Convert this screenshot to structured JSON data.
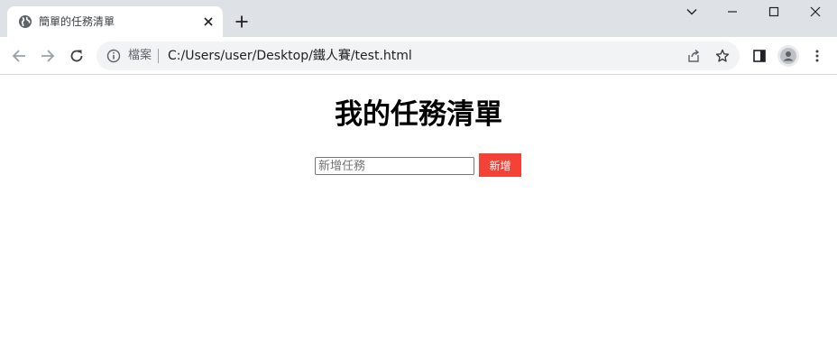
{
  "browser": {
    "tab": {
      "title": "簡單的任務清單"
    },
    "omnibox": {
      "security_label": "檔案",
      "url": "C:/Users/user/Desktop/鐵人賽/test.html"
    }
  },
  "page": {
    "title": "我的任務清單",
    "task_input": {
      "placeholder": "新增任務",
      "value": ""
    },
    "add_button_label": "新增",
    "accent_color": "#f44336"
  }
}
